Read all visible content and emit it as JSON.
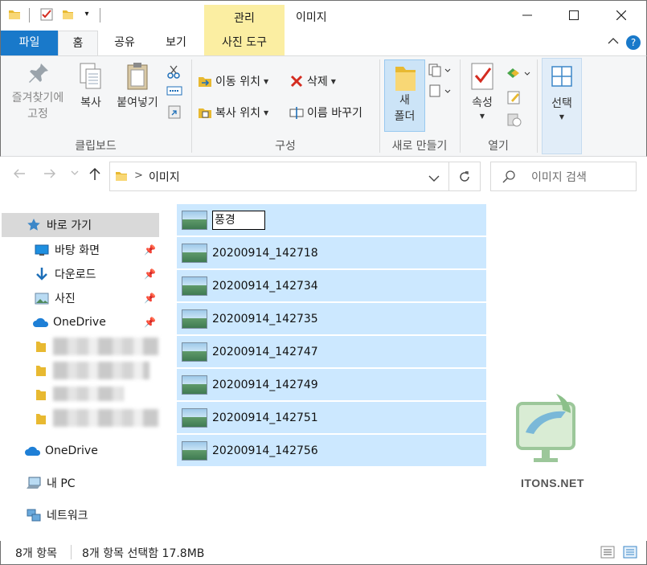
{
  "title_bar": {
    "context_tab_label": "관리",
    "window_title": "이미지",
    "minimize": "—",
    "maximize": "☐",
    "close": "✕"
  },
  "tabs": [
    {
      "label": "파일"
    },
    {
      "label": "홈"
    },
    {
      "label": "공유"
    },
    {
      "label": "보기"
    },
    {
      "label": "사진 도구"
    }
  ],
  "ribbon": {
    "clipboard": {
      "pin_label_1": "즐겨찾기에",
      "pin_label_2": "고정",
      "copy": "복사",
      "paste": "붙여넣기",
      "group": "클립보드"
    },
    "organize": {
      "move_to": "이동 위치",
      "copy_to": "복사 위치",
      "delete": "삭제",
      "rename": "이름 바꾸기",
      "group": "구성"
    },
    "new": {
      "new_folder_1": "새",
      "new_folder_2": "폴더",
      "group": "새로 만들기"
    },
    "open": {
      "properties": "속성",
      "group": "열기"
    },
    "select": {
      "select": "선택"
    }
  },
  "address_bar": {
    "separator": ">",
    "path": "이미지",
    "search_placeholder": "이미지 검색"
  },
  "nav_pane": {
    "quick_access": "바로 가기",
    "items": [
      {
        "label": "바탕 화면"
      },
      {
        "label": "다운로드"
      },
      {
        "label": "사진"
      },
      {
        "label": "OneDrive"
      }
    ],
    "onedrive": "OneDrive",
    "this_pc": "내 PC",
    "network": "네트워크"
  },
  "files": [
    {
      "name": "풍경",
      "renaming": true
    },
    {
      "name": "20200914_142718"
    },
    {
      "name": "20200914_142734"
    },
    {
      "name": "20200914_142735"
    },
    {
      "name": "20200914_142747"
    },
    {
      "name": "20200914_142749"
    },
    {
      "name": "20200914_142751"
    },
    {
      "name": "20200914_142756"
    }
  ],
  "watermark": "ITONS.NET",
  "status_bar": {
    "item_count": "8개 항목",
    "selection": "8개 항목 선택함 17.8MB"
  },
  "colors": {
    "file_tab": "#1979ca",
    "context_tab": "#fbeea2",
    "selection": "#cce8ff"
  }
}
